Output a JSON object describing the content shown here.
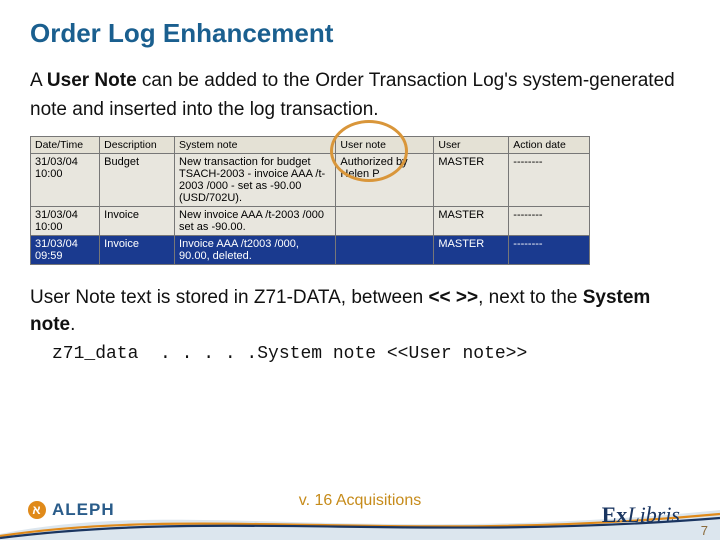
{
  "title": "Order Log Enhancement",
  "intro_parts": {
    "p1": "A ",
    "bold1": "User Note",
    "p2": " can be added to the Order Transaction Log's system-generated note and inserted into the log transaction."
  },
  "table": {
    "headers": [
      "Date/Time",
      "Description",
      "System note",
      "User note",
      "User",
      "Action date"
    ],
    "rows": [
      {
        "sel": false,
        "cells": [
          "31/03/04 10:00",
          "Budget",
          "New transaction for budget TSACH-2003 - invoice AAA /t-2003 /000 - set as -90.00 (USD/702U).",
          "Authorized by Helen P",
          "MASTER",
          "--------"
        ]
      },
      {
        "sel": false,
        "cells": [
          "31/03/04 10:00",
          "Invoice",
          "New invoice AAA /t-2003 /000 set as -90.00.",
          "",
          "MASTER",
          "--------"
        ]
      },
      {
        "sel": true,
        "cells": [
          "31/03/04 09:59",
          "Invoice",
          "Invoice AAA /t2003 /000, 90.00, deleted.",
          "",
          "MASTER",
          "--------"
        ]
      }
    ]
  },
  "note2_parts": {
    "p1": "User Note text is stored in Z71-DATA, between ",
    "bold1": "<< >>",
    "p2": ", next to the ",
    "bold2": "System note",
    "p3": "."
  },
  "code_line": "z71_data  . . . . .System note <<User note>>",
  "footer": {
    "deck_label": "v. 16 Acquisitions",
    "aleph": "ALEPH",
    "exlibris_ex": "Ex",
    "exlibris_rest": "Libris",
    "page": "7"
  }
}
